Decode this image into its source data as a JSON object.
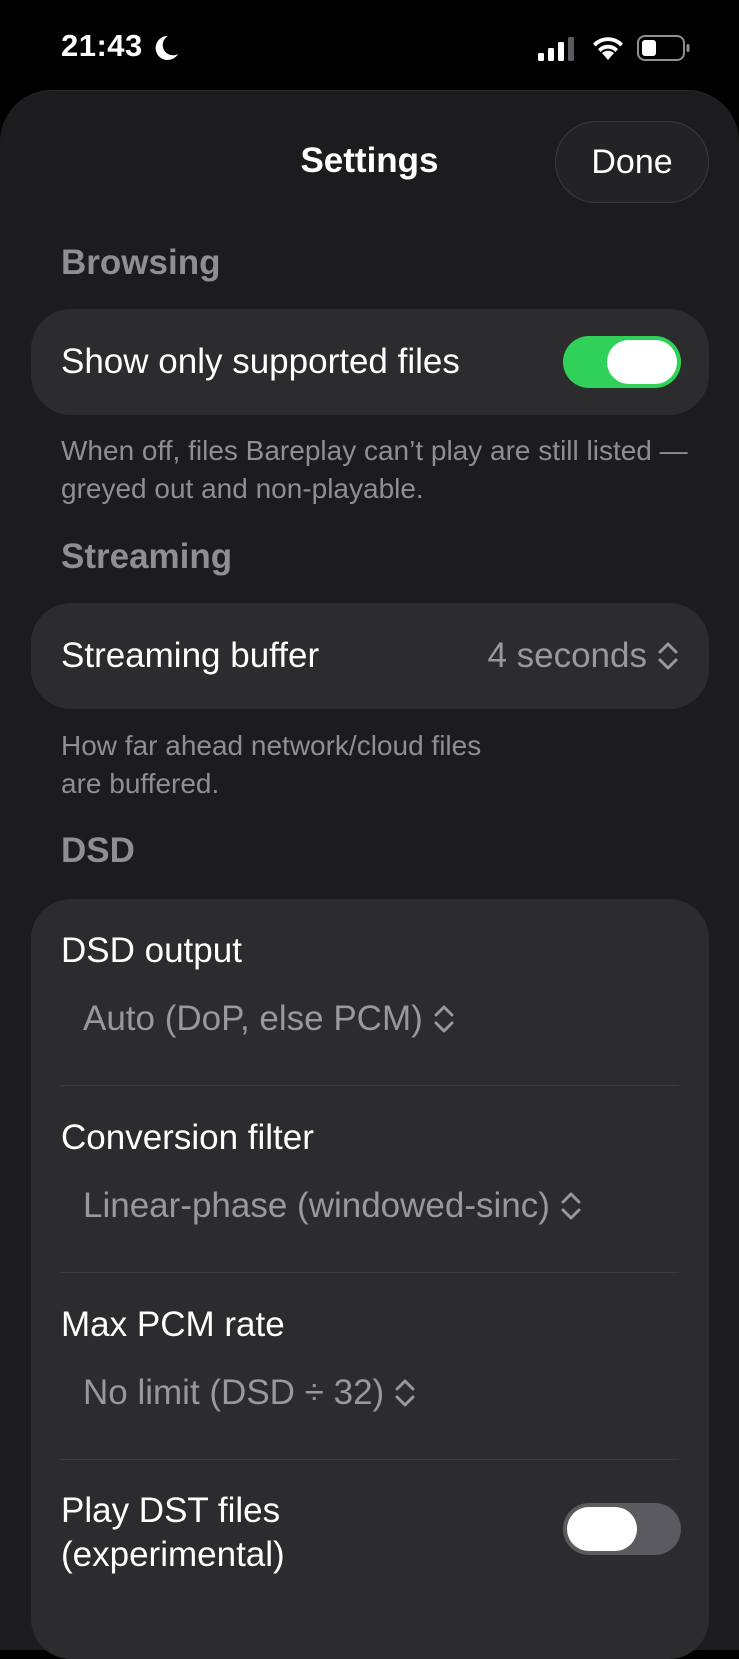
{
  "status_bar": {
    "time": "21:43",
    "icons": [
      "moon-icon",
      "cellular-signal-icon",
      "wifi-icon",
      "battery-icon"
    ]
  },
  "header": {
    "title": "Settings",
    "done_label": "Done"
  },
  "browsing": {
    "section_title": "Browsing",
    "show_supported_label": "Show only supported files",
    "show_supported_on": true,
    "footer": "When off, files Bareplay can’t play are still listed — greyed out and non-playable."
  },
  "streaming": {
    "section_title": "Streaming",
    "buffer_label": "Streaming buffer",
    "buffer_value": "4 seconds",
    "footer_line1": "How far ahead network/cloud files",
    "footer_line2": "are buffered."
  },
  "dsd": {
    "section_title": "DSD",
    "output_label": "DSD output",
    "output_value": "Auto (DoP, else PCM)",
    "filter_label": "Conversion filter",
    "filter_value": "Linear-phase (windowed-sinc)",
    "max_rate_label": "Max PCM rate",
    "max_rate_value": "No limit (DSD ÷ 32)",
    "dst_label_line1": "Play DST files",
    "dst_label_line2": "(experimental)",
    "dst_on": false
  },
  "colors": {
    "accent_green": "#30d158",
    "sheet_bg": "#1c1c1e",
    "group_bg": "#2c2c2e",
    "secondary_text": "#8e8e93"
  }
}
